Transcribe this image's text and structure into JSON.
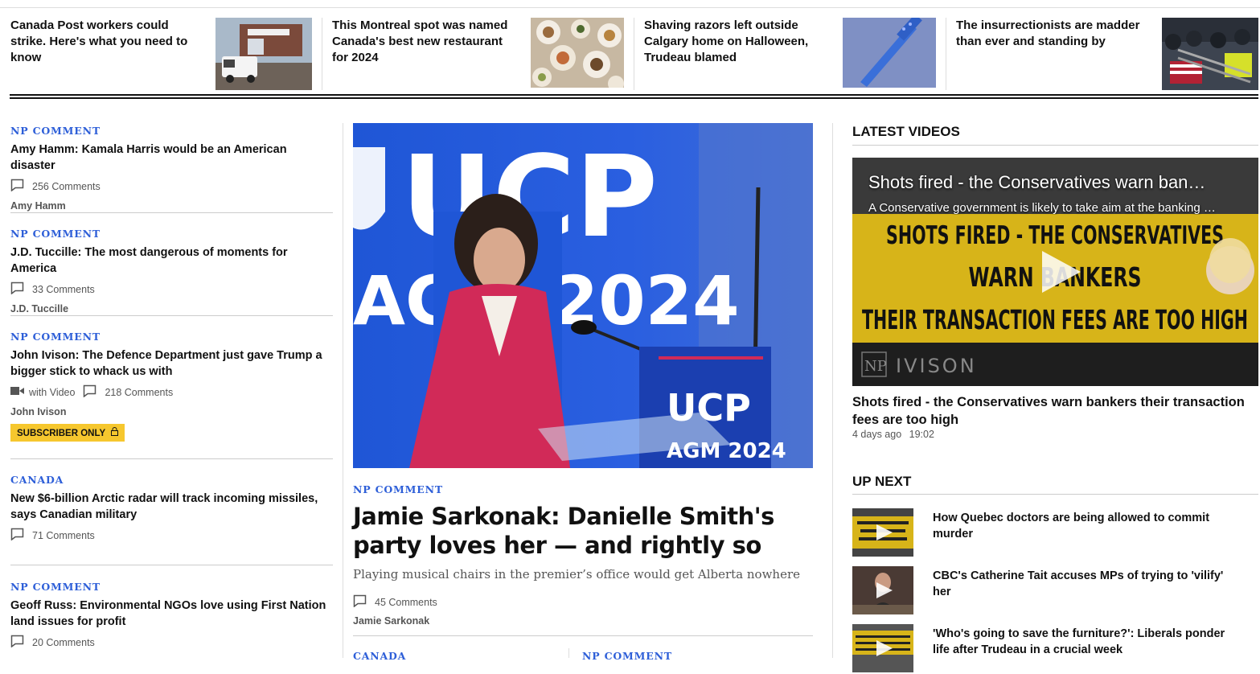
{
  "top_strip": [
    {
      "title": "Canada Post workers could strike. Here's what you need to know",
      "thumb": "canada-post-truck"
    },
    {
      "title": "This Montreal spot was named Canada's best new restaurant for 2024",
      "thumb": "restaurant-plates"
    },
    {
      "title": "Shaving razors left outside Calgary home on Halloween, Trudeau blamed",
      "thumb": "blue-razor"
    },
    {
      "title": "The insurrectionists are madder than ever and standing by",
      "thumb": "crowd-barricade"
    }
  ],
  "left_stories": [
    {
      "kicker": "NP COMMENT",
      "title": "Amy Hamm: Kamala Harris would be an American disaster",
      "comments": "256 Comments",
      "author": "Amy Hamm"
    },
    {
      "kicker": "NP COMMENT",
      "title": "J.D. Tuccille: The most dangerous of moments for America",
      "comments": "33 Comments",
      "author": "J.D. Tuccille"
    },
    {
      "kicker": "NP COMMENT",
      "title": "John Ivison: The Defence Department just gave Trump a bigger stick to whack us with",
      "video": "with Video",
      "comments": "218 Comments",
      "author": "John Ivison",
      "badge": "SUBSCRIBER ONLY"
    },
    {
      "kicker": "CANADA",
      "title": "New $6-billion Arctic radar will track incoming missiles, says Canadian military",
      "comments": "71 Comments"
    },
    {
      "kicker": "NP COMMENT",
      "title": "Geoff Russ: Environmental NGOs love using First Nation land issues for profit",
      "comments": "20 Comments"
    }
  ],
  "hero": {
    "kicker": "NP COMMENT",
    "title": "Jamie Sarkonak: Danielle Smith's party loves her — and rightly so",
    "dek": "Playing musical chairs in the premier’s office would get Alberta nowhere",
    "comments": "45 Comments",
    "author": "Jamie Sarkonak",
    "image_text": {
      "top": "UCP",
      "sub": "AGM 2024",
      "podium_top": "UCP",
      "podium_sub": "AGM 2024"
    }
  },
  "bottom_kickers": [
    "CANADA",
    "NP COMMENT"
  ],
  "latest_videos": {
    "heading": "LATEST VIDEOS",
    "video": {
      "overlay_title": "Shots fired - the Conservatives warn ban…",
      "overlay_desc": "A Conservative government is likely to take aim at the banking …",
      "banner_line1": "SHOTS FIRED - THE CONSERVATIVES",
      "banner_line2": "WARN BANKERS",
      "banner_line3": "THEIR TRANSACTION FEES ARE TOO HIGH",
      "brand": "IVISON",
      "brand_mark": "NP"
    },
    "title": "Shots fired - the Conservatives warn bankers their transaction fees are too high",
    "age": "4 days ago",
    "duration": "19:02"
  },
  "up_next": {
    "heading": "UP NEXT",
    "items": [
      {
        "title": "How Quebec doctors are being allowed to commit murder"
      },
      {
        "title": "CBC's Catherine Tait accuses MPs of trying to 'vilify' her"
      },
      {
        "title": "'Who's going to save the furniture?': Liberals ponder life after Trudeau in a crucial week"
      }
    ]
  },
  "colors": {
    "kicker": "#2e5fd8",
    "badge": "#f6c72e",
    "video_banner": "#d7b419"
  }
}
